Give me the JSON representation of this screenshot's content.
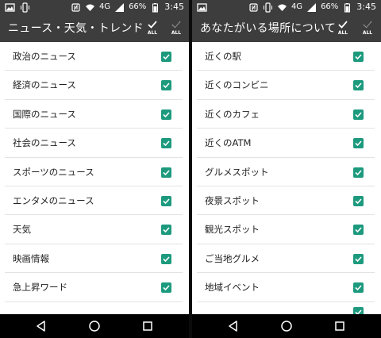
{
  "status_bar": {
    "battery": "66%",
    "time": "3:45",
    "network": "4G"
  },
  "left_screen": {
    "title": "ニュース・天気・トレンド",
    "check_all_label": "ALL",
    "uncheck_all_label": "ALL",
    "items": [
      {
        "label": "政治のニュース",
        "checked": true
      },
      {
        "label": "経済のニュース",
        "checked": true
      },
      {
        "label": "国際のニュース",
        "checked": true
      },
      {
        "label": "社会のニュース",
        "checked": true
      },
      {
        "label": "スポーツのニュース",
        "checked": true
      },
      {
        "label": "エンタメのニュース",
        "checked": true
      },
      {
        "label": "天気",
        "checked": true
      },
      {
        "label": "映画情報",
        "checked": true
      },
      {
        "label": "急上昇ワード",
        "checked": true
      }
    ]
  },
  "right_screen": {
    "title": "あなたがいる場所について",
    "check_all_label": "ALL",
    "uncheck_all_label": "ALL",
    "items": [
      {
        "label": "近くの駅",
        "checked": true
      },
      {
        "label": "近くのコンビニ",
        "checked": true
      },
      {
        "label": "近くのカフェ",
        "checked": true
      },
      {
        "label": "近くのATM",
        "checked": true
      },
      {
        "label": "グルメスポット",
        "checked": true
      },
      {
        "label": "夜景スポット",
        "checked": true
      },
      {
        "label": "観光スポット",
        "checked": true
      },
      {
        "label": "ご当地グルメ",
        "checked": true
      },
      {
        "label": "地域イベント",
        "checked": true
      }
    ]
  },
  "colors": {
    "toolbar": "#3d3d3d",
    "checkbox": "#1d9a7e",
    "navbar": "#000000"
  }
}
